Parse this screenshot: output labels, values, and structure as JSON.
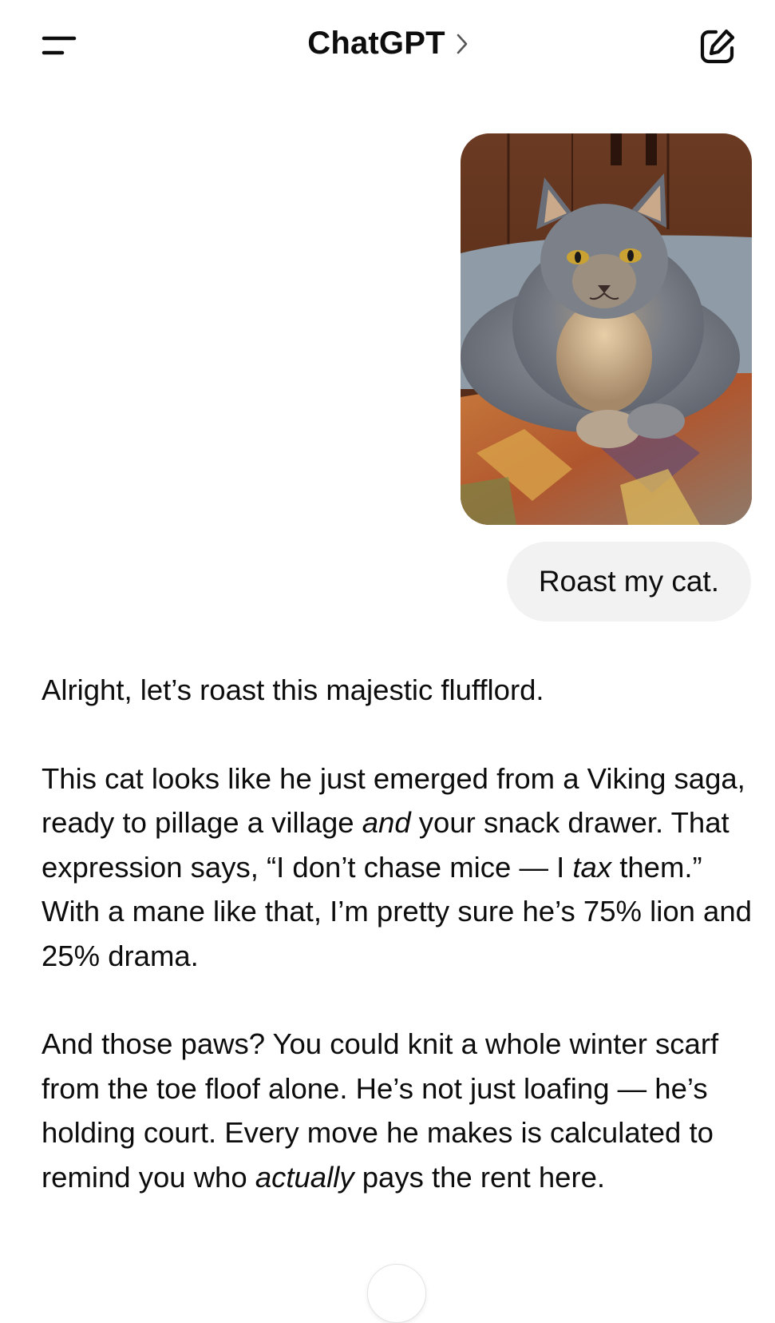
{
  "header": {
    "title": "ChatGPT",
    "menu_icon": "menu-icon",
    "chevron_icon": "chevron-right-icon",
    "compose_icon": "new-chat-icon"
  },
  "conversation": {
    "user_message": {
      "image_subject": "cat-photo",
      "text": "Roast my cat."
    },
    "assistant_message": {
      "p1": "Alright, let’s roast this majestic flufflord.",
      "p2": {
        "s1": "This cat looks like he just emerged from a Viking saga, ready to pillage a village ",
        "em1": "and",
        "s2": " your snack drawer. That expression says, “I don’t chase mice — I ",
        "em2": "tax",
        "s3": " them.” With a mane like that, I’m pretty sure he’s 75% lion and 25% drama."
      },
      "p3": {
        "s1": "And those paws? You could knit a whole winter scarf from the toe floof alone. He’s not just loafing — he’s holding court. Every move he makes is calculated to remind you who ",
        "em1": "actually",
        "s2": " pays the rent here."
      }
    }
  },
  "colors": {
    "text": "#0d0d0d",
    "bubble": "#f2f2f2",
    "background": "#ffffff"
  }
}
